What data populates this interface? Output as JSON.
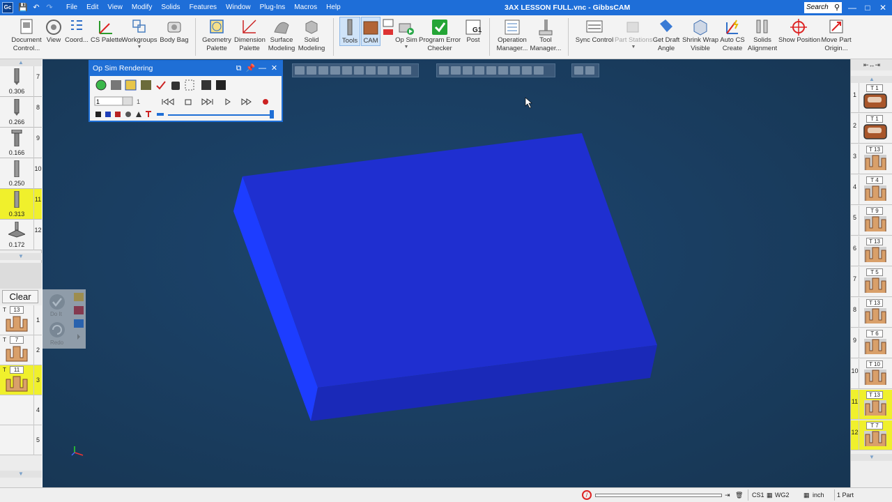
{
  "app": {
    "window_title": "3AX LESSON FULL.vnc - GibbsCAM",
    "logo": "Gc",
    "search_label": "Search"
  },
  "menu": [
    "File",
    "Edit",
    "View",
    "Modify",
    "Solids",
    "Features",
    "Window",
    "Plug-Ins",
    "Macros",
    "Help"
  ],
  "ribbon": {
    "document_control": [
      "Document",
      "Control..."
    ],
    "view": "View",
    "coord": "Coord...",
    "cs_palette": "CS Palette",
    "workgroups": "Workgroups",
    "body_bag": "Body Bag",
    "geometry_palette": [
      "Geometry",
      "Palette"
    ],
    "dimension_palette": [
      "Dimension",
      "Palette"
    ],
    "surface_modeling": [
      "Surface",
      "Modeling"
    ],
    "solid_modeling": [
      "Solid",
      "Modeling"
    ],
    "tools": "Tools",
    "cam": "CAM",
    "op_sim": "Op Sim",
    "program_error_checker": [
      "Program Error",
      "Checker"
    ],
    "post": "Post",
    "post_badge": "G1",
    "operation_manager": [
      "Operation",
      "Manager..."
    ],
    "tool_manager": [
      "Tool",
      "Manager..."
    ],
    "sync_control": "Sync Control",
    "part_stations": "Part Stations",
    "get_draft_angle": [
      "Get Draft",
      "Angle"
    ],
    "shrink_wrap_visible": [
      "Shrink Wrap",
      "Visible"
    ],
    "auto_cs_create": [
      "Auto CS",
      "Create"
    ],
    "solids_alignment": [
      "Solids",
      "Alignment"
    ],
    "show_position": "Show Position",
    "move_part_origin": [
      "Move Part",
      "Origin..."
    ]
  },
  "left_tools": [
    {
      "num": "7",
      "value": "0.306",
      "highlighted": false
    },
    {
      "num": "8",
      "value": "0.266",
      "highlighted": false
    },
    {
      "num": "9",
      "value": "0.166",
      "highlighted": false
    },
    {
      "num": "10",
      "value": "0.250",
      "highlighted": false
    },
    {
      "num": "11",
      "value": "0.313",
      "highlighted": true
    },
    {
      "num": "12",
      "value": "0.172",
      "highlighted": false
    }
  ],
  "clear_button": "Clear",
  "doit_panel": {
    "do_it": "Do It",
    "redo": "Redo"
  },
  "left_ops": [
    {
      "tool": "13",
      "num": "1",
      "highlighted": false
    },
    {
      "tool": "7",
      "num": "2",
      "highlighted": false
    },
    {
      "tool": "11",
      "num": "3",
      "highlighted": true
    },
    {
      "tool": "",
      "num": "4",
      "highlighted": false
    },
    {
      "tool": "",
      "num": "5",
      "highlighted": false
    }
  ],
  "right_ops": [
    {
      "num": "1",
      "tool": "T 1",
      "kind": "contour",
      "highlighted": false
    },
    {
      "num": "2",
      "tool": "T 1",
      "kind": "contour",
      "highlighted": false
    },
    {
      "num": "3",
      "tool": "T 13",
      "kind": "pocket",
      "highlighted": false
    },
    {
      "num": "4",
      "tool": "T 4",
      "kind": "pocket",
      "highlighted": false
    },
    {
      "num": "5",
      "tool": "T 9",
      "kind": "pocket",
      "highlighted": false
    },
    {
      "num": "6",
      "tool": "T 13",
      "kind": "pocket",
      "highlighted": false
    },
    {
      "num": "7",
      "tool": "T 5",
      "kind": "pocket",
      "highlighted": false
    },
    {
      "num": "8",
      "tool": "T 13",
      "kind": "pocket",
      "highlighted": false
    },
    {
      "num": "9",
      "tool": "T 6",
      "kind": "pocket",
      "highlighted": false
    },
    {
      "num": "10",
      "tool": "T 10",
      "kind": "pocket",
      "highlighted": false
    },
    {
      "num": "11",
      "tool": "T 13",
      "kind": "pocket",
      "highlighted": true
    },
    {
      "num": "12",
      "tool": "T 7",
      "kind": "pocket",
      "highlighted": true
    }
  ],
  "opsim": {
    "title": "Op Sim Rendering",
    "op_field": "1",
    "op_field2": "1",
    "progress": 1.0
  },
  "status": {
    "cs": "CS1",
    "wg": "WG2",
    "units": "inch",
    "parts": "1 Part"
  },
  "colors": {
    "title_bar": "#1e6ed8",
    "viewport_bg": "#1c4065",
    "part_top": "#1f2fd0",
    "highlight": "#f0f02c"
  }
}
